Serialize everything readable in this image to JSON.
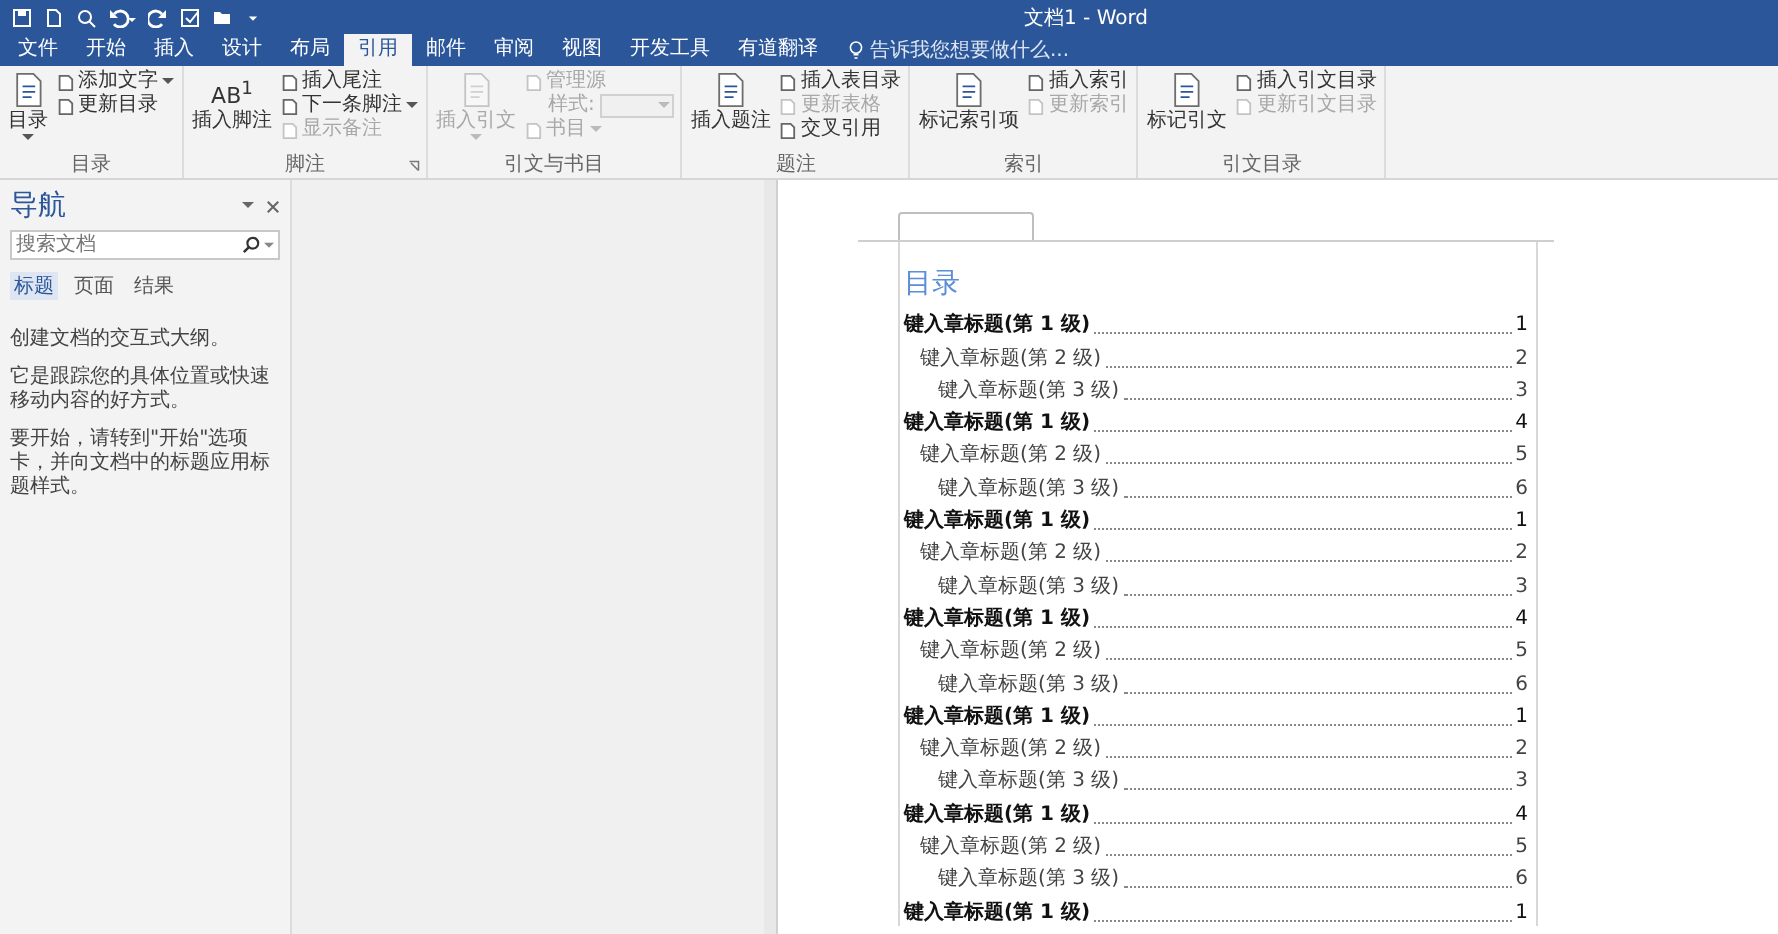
{
  "window": {
    "title": "文档1 - Word"
  },
  "tabs": [
    {
      "label": "文件",
      "selected": false
    },
    {
      "label": "开始",
      "selected": false
    },
    {
      "label": "插入",
      "selected": false
    },
    {
      "label": "设计",
      "selected": false
    },
    {
      "label": "布局",
      "selected": false
    },
    {
      "label": "引用",
      "selected": true
    },
    {
      "label": "邮件",
      "selected": false
    },
    {
      "label": "审阅",
      "selected": false
    },
    {
      "label": "视图",
      "selected": false
    },
    {
      "label": "开发工具",
      "selected": false
    },
    {
      "label": "有道翻译",
      "selected": false
    }
  ],
  "tell_me": {
    "placeholder": "告诉我您想要做什么..."
  },
  "ribbon": [
    {
      "label": "目录",
      "launcher": false,
      "large": [
        {
          "label": "目录",
          "disabled": false,
          "dropdown": true
        }
      ],
      "small": [
        {
          "kind": "button",
          "label": "添加文字",
          "disabled": false,
          "dropdown": true
        },
        {
          "kind": "button",
          "label": "更新目录",
          "disabled": false,
          "dropdown": false
        }
      ]
    },
    {
      "label": "脚注",
      "launcher": true,
      "large": [
        {
          "label": "插入脚注",
          "disabled": false,
          "dropdown": false,
          "icon_text": "AB$^{1}$"
        }
      ],
      "small": [
        {
          "kind": "button",
          "label": "插入尾注",
          "disabled": false,
          "dropdown": false
        },
        {
          "kind": "button",
          "label": "下一条脚注",
          "disabled": false,
          "dropdown": true
        },
        {
          "kind": "button",
          "label": "显示备注",
          "disabled": true,
          "dropdown": false
        }
      ]
    },
    {
      "label": "引文与书目",
      "launcher": false,
      "large": [
        {
          "label": "插入引文",
          "disabled": true,
          "dropdown": true
        }
      ],
      "small": [
        {
          "kind": "button",
          "label": "管理源",
          "disabled": true,
          "dropdown": false
        },
        {
          "kind": "combo",
          "label": "样式:",
          "disabled": true,
          "dropdown": true
        },
        {
          "kind": "button",
          "label": "书目",
          "disabled": true,
          "dropdown": true
        }
      ]
    },
    {
      "label": "题注",
      "launcher": false,
      "large": [
        {
          "label": "插入题注",
          "disabled": false,
          "dropdown": false
        }
      ],
      "small": [
        {
          "kind": "button",
          "label": "插入表目录",
          "disabled": false,
          "dropdown": false
        },
        {
          "kind": "button",
          "label": "更新表格",
          "disabled": true,
          "dropdown": false
        },
        {
          "kind": "button",
          "label": "交叉引用",
          "disabled": false,
          "dropdown": false
        }
      ]
    },
    {
      "label": "索引",
      "launcher": false,
      "large": [
        {
          "label": "标记索引项",
          "disabled": false,
          "dropdown": false
        }
      ],
      "small": [
        {
          "kind": "button",
          "label": "插入索引",
          "disabled": false,
          "dropdown": false
        },
        {
          "kind": "button",
          "label": "更新索引",
          "disabled": true,
          "dropdown": false
        }
      ]
    },
    {
      "label": "引文目录",
      "launcher": false,
      "large": [
        {
          "label": "标记引文",
          "disabled": false,
          "dropdown": false
        }
      ],
      "small": [
        {
          "kind": "button",
          "label": "插入引文目录",
          "disabled": false,
          "dropdown": false
        },
        {
          "kind": "button",
          "label": "更新引文目录",
          "disabled": true,
          "dropdown": false
        }
      ]
    }
  ],
  "navigation": {
    "title": "导航",
    "search": {
      "placeholder": "搜索文档"
    },
    "tabs": [
      {
        "label": "标题",
        "selected": true
      },
      {
        "label": "页面",
        "selected": false
      },
      {
        "label": "结果",
        "selected": false
      }
    ],
    "paragraphs": [
      "创建文档的交互式大纲。",
      "它是跟踪您的具体位置或快速移动内容的好方式。",
      "要开始，请转到\"开始\"选项卡，并向文档中的标题应用标题样式。"
    ]
  },
  "document": {
    "toc_title": "目录",
    "toc": [
      {
        "text": "键入章标题(第 1 级)",
        "page": "1",
        "children": [
          {
            "text": "键入章标题(第 2 级)",
            "page": "2",
            "children": [
              {
                "text": "键入章标题(第 3 级)",
                "page": "3"
              }
            ]
          }
        ]
      },
      {
        "text": "键入章标题(第 1 级)",
        "page": "4",
        "children": [
          {
            "text": "键入章标题(第 2 级)",
            "page": "5",
            "children": [
              {
                "text": "键入章标题(第 3 级)",
                "page": "6"
              }
            ]
          }
        ]
      },
      {
        "text": "键入章标题(第 1 级)",
        "page": "1",
        "children": [
          {
            "text": "键入章标题(第 2 级)",
            "page": "2",
            "children": [
              {
                "text": "键入章标题(第 3 级)",
                "page": "3"
              }
            ]
          }
        ]
      },
      {
        "text": "键入章标题(第 1 级)",
        "page": "4",
        "children": [
          {
            "text": "键入章标题(第 2 级)",
            "page": "5",
            "children": [
              {
                "text": "键入章标题(第 3 级)",
                "page": "6"
              }
            ]
          }
        ]
      },
      {
        "text": "键入章标题(第 1 级)",
        "page": "1",
        "children": [
          {
            "text": "键入章标题(第 2 级)",
            "page": "2",
            "children": [
              {
                "text": "键入章标题(第 3 级)",
                "page": "3"
              }
            ]
          }
        ]
      },
      {
        "text": "键入章标题(第 1 级)",
        "page": "4",
        "children": [
          {
            "text": "键入章标题(第 2 级)",
            "page": "5",
            "children": [
              {
                "text": "键入章标题(第 3 级)",
                "page": "6"
              }
            ]
          }
        ]
      },
      {
        "text": "键入章标题(第 1 级)",
        "page": "1"
      }
    ]
  }
}
